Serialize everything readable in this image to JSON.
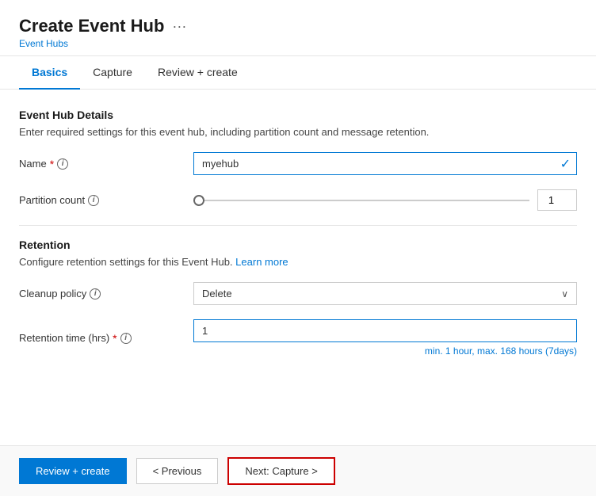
{
  "header": {
    "title": "Create Event Hub",
    "ellipsis": "···",
    "subtitle": "Event Hubs"
  },
  "tabs": [
    {
      "id": "basics",
      "label": "Basics",
      "active": true
    },
    {
      "id": "capture",
      "label": "Capture",
      "active": false
    },
    {
      "id": "review",
      "label": "Review + create",
      "active": false
    }
  ],
  "form": {
    "section1_title": "Event Hub Details",
    "section1_desc": "Enter required settings for this event hub, including partition count and message retention.",
    "name_label": "Name",
    "name_value": "myehub",
    "partition_label": "Partition count",
    "partition_value": "1",
    "section2_title": "Retention",
    "section2_desc": "Configure retention settings for this Event Hub.",
    "learn_more": "Learn more",
    "cleanup_label": "Cleanup policy",
    "cleanup_value": "Delete",
    "retention_label": "Retention time (hrs)",
    "retention_value": "1",
    "retention_hint": "min. 1 hour, max. 168 hours (7days)"
  },
  "footer": {
    "review_create_label": "Review + create",
    "previous_label": "< Previous",
    "next_label": "Next: Capture >"
  },
  "icons": {
    "info": "i",
    "check": "✓",
    "chevron_down": "∨"
  }
}
